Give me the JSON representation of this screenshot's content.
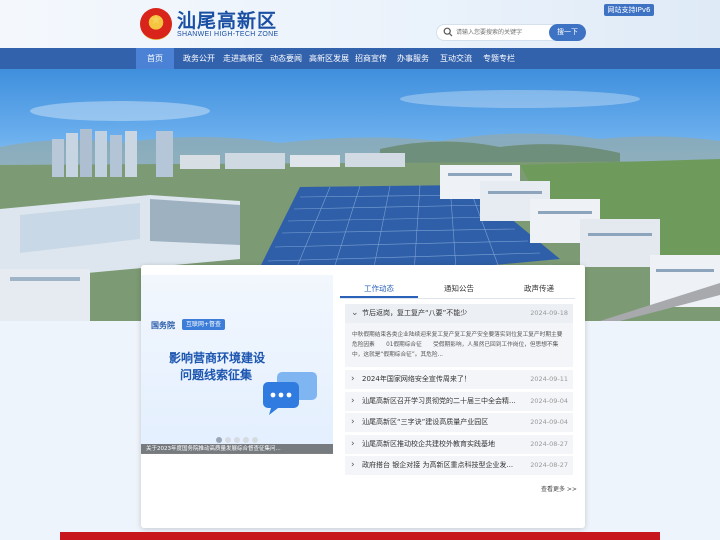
{
  "header": {
    "site_name": "汕尾高新区",
    "site_sub": "SHANWEI HIGH-TECH ZONE",
    "ipv6_badge": "网站支持IPv6",
    "search_placeholder": "请输入您要搜索的关键字",
    "search_button": "搜一下"
  },
  "nav": {
    "items": [
      {
        "label": "首页"
      },
      {
        "label": "政务公开"
      },
      {
        "label": "走进高新区"
      },
      {
        "label": "动态要闻"
      },
      {
        "label": "高新区发展"
      },
      {
        "label": "招商宣传"
      },
      {
        "label": "办事服务"
      },
      {
        "label": "互动交流"
      },
      {
        "label": "专题专栏"
      }
    ]
  },
  "banner": {
    "badge1": "国务院",
    "badge2": "互联网+督查",
    "title_line1": "影响营商环境建设",
    "title_line2": "问题线索征集",
    "caption": "关于2023年度国务院推动高质量发展综合督查征集问..."
  },
  "tabs": [
    {
      "label": "工作动态"
    },
    {
      "label": "通知公告"
    },
    {
      "label": "政声传递"
    }
  ],
  "news": {
    "top": {
      "title": "节后返岗，复工复产“八要”不能少",
      "date": "2024-09-18",
      "summary": "中秋假期结束各类企业陆续迎来复工复产复工复产安全要落实到位复工复产时期主要危险因素　　01假期综合征　　受假期影响，人虽然已回到工作岗位，但思想不集中，这就是“假期综合征”。其危险..."
    },
    "items": [
      {
        "title": "2024年国家网络安全宣传周来了！",
        "date": "2024-09-11"
      },
      {
        "title": "汕尾高新区召开学习贯彻党的二十届三中全会精...",
        "date": "2024-09-04"
      },
      {
        "title": "汕尾高新区“三字诀”建设高质量产业园区",
        "date": "2024-09-04"
      },
      {
        "title": "汕尾高新区推动校企共建校外教育实践基地",
        "date": "2024-08-27"
      },
      {
        "title": "政府搭台 银企对接 为高新区重点科技型企业发...",
        "date": "2024-08-27"
      }
    ],
    "more": "查看更多 >>"
  }
}
